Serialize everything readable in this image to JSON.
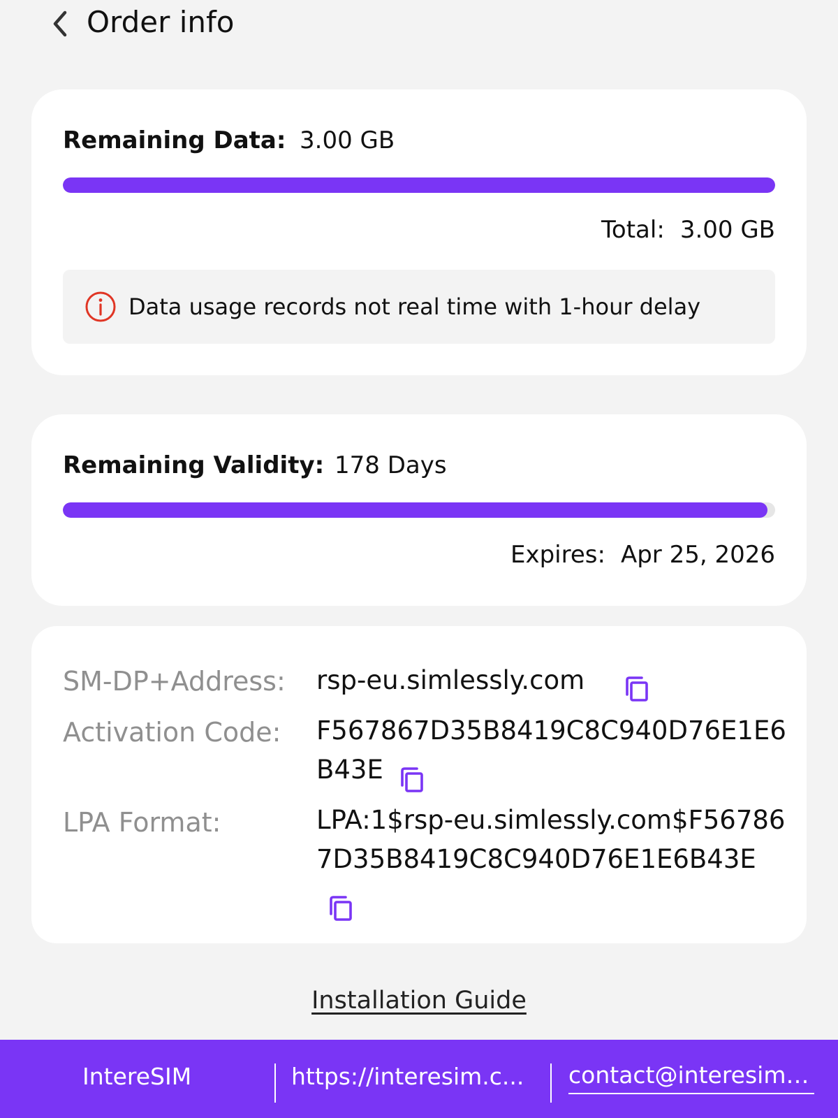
{
  "header": {
    "back_icon": "chevron-left-icon",
    "title": "Order info"
  },
  "data_card": {
    "label": "Remaining Data:",
    "value": "3.00 GB",
    "progress_fraction": 1.0,
    "total_label": "Total:",
    "total_value": "3.00 GB",
    "notice_icon": "info-circle-icon",
    "notice_text": "Data usage records not real time with 1-hour delay"
  },
  "validity_card": {
    "label": "Remaining Validity:",
    "value": "178 Days",
    "progress_fraction": 0.989,
    "expires_label": "Expires:",
    "expires_value": "Apr 25, 2026"
  },
  "codes_card": {
    "smdp_label": "SM-DP+Address:",
    "smdp_value": "rsp-eu.simlessly.com",
    "activation_label": "Activation Code:",
    "activation_value": "F567867D35B8419C8C940D76E1E6B43E",
    "lpa_label": "LPA Format:",
    "lpa_value": "LPA:1$rsp-eu.simlessly.com$F567867D35B8419C8C940D76E1E6B43E",
    "copy_icon": "copy-icon"
  },
  "installation_guide": "Installation Guide",
  "footer": {
    "brand": "IntereSIM",
    "website": "https://interesim.c...",
    "email": "contact@interesim...."
  },
  "colors": {
    "accent": "#7a35f5",
    "background": "#f3f3f3",
    "card": "#ffffff",
    "info_red": "#e03524",
    "label_gray": "#8f8f8f"
  }
}
